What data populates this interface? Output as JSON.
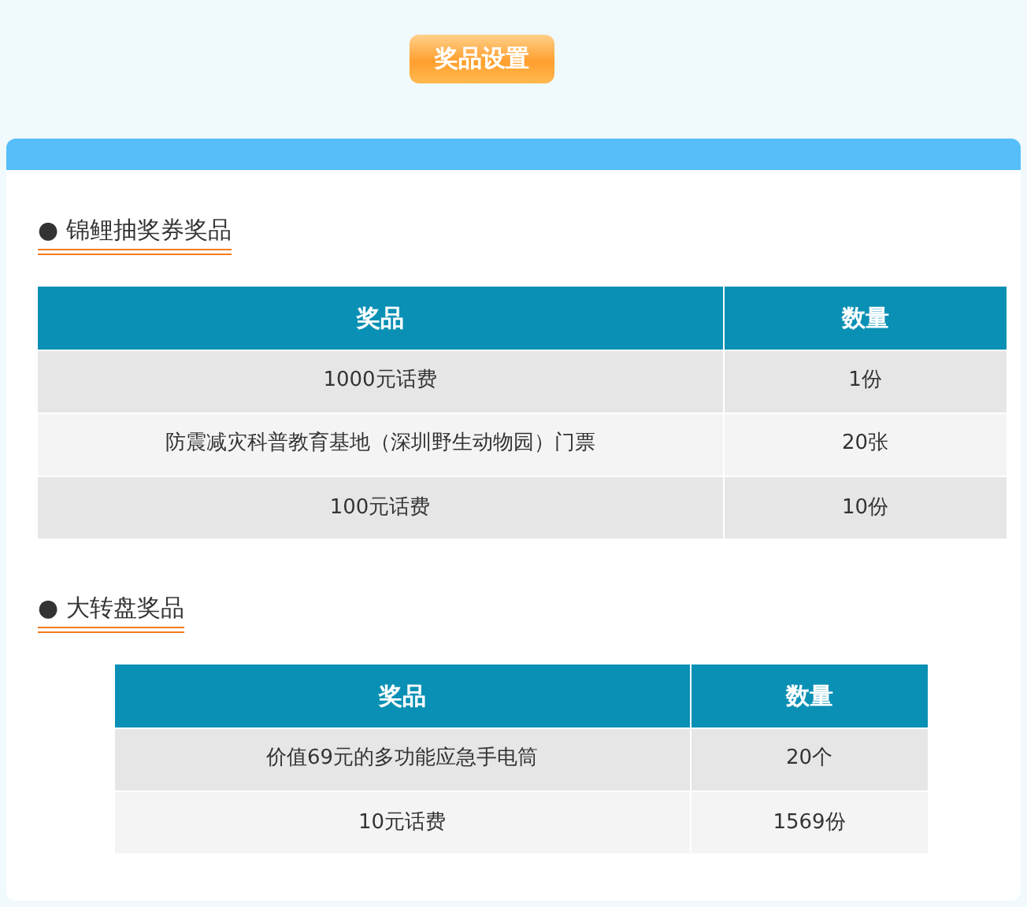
{
  "title_button": "奖品设置",
  "sections": [
    {
      "heading": "● 锦鲤抽奖券奖品",
      "columns": [
        "奖品",
        "数量"
      ],
      "rows": [
        [
          "1000元话费",
          "1份"
        ],
        [
          "防震减灾科普教育基地（深圳野生动物园）门票",
          "20张"
        ],
        [
          "100元话费",
          "10份"
        ]
      ]
    },
    {
      "heading": "● 大转盘奖品",
      "columns": [
        "奖品",
        "数量"
      ],
      "rows": [
        [
          "价值69元的多功能应急手电筒",
          "20个"
        ],
        [
          "10元话费",
          "1569份"
        ]
      ]
    }
  ]
}
